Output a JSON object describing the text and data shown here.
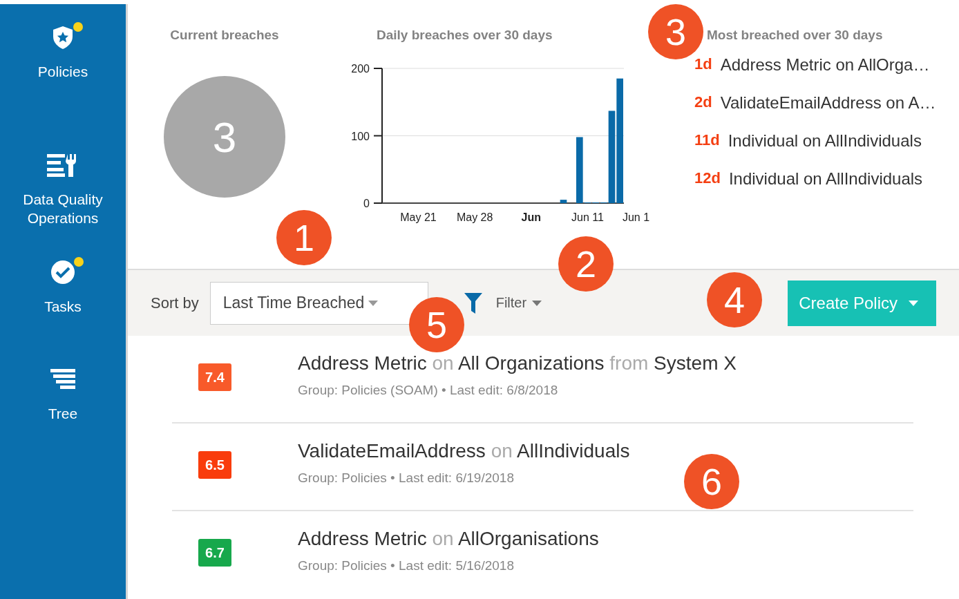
{
  "sidebar": {
    "items": [
      {
        "label": "Policies",
        "badge": true
      },
      {
        "label": "Data Quality Operations",
        "badge": false
      },
      {
        "label": "Tasks",
        "badge": true
      },
      {
        "label": "Tree",
        "badge": false
      }
    ]
  },
  "current_breaches": {
    "title": "Current breaches",
    "count": "3"
  },
  "daily_breaches": {
    "title": "Daily breaches over 30 days",
    "chart_data": {
      "type": "bar",
      "categories": [
        null,
        null,
        null,
        null,
        "May 21",
        null,
        null,
        null,
        null,
        null,
        null,
        "May 28",
        null,
        null,
        null,
        null,
        null,
        null,
        "Jun",
        null,
        null,
        null,
        null,
        null,
        null,
        "Jun 11",
        null,
        null,
        null,
        null,
        null,
        "Jun 1"
      ],
      "series": [
        {
          "color": "#0a6aa8",
          "values": [
            0,
            0,
            0,
            0,
            0,
            0,
            0,
            0,
            0,
            0,
            0,
            0,
            0,
            0,
            0,
            0,
            0,
            0,
            0,
            0,
            0,
            0,
            5,
            0,
            98,
            1,
            1,
            1,
            137,
            185,
            null,
            null
          ]
        }
      ],
      "ylim": [
        0,
        200
      ],
      "yticks": [
        0,
        100,
        200
      ]
    }
  },
  "most_breached": {
    "title": "Most breached over 30 days",
    "items": [
      {
        "age": "1d",
        "text": "Address Metric on AllOrga…"
      },
      {
        "age": "2d",
        "text": "ValidateEmailAddress on A…"
      },
      {
        "age": "11d",
        "text": "Individual on AllIndividuals"
      },
      {
        "age": "12d",
        "text": "Individual on AllIndividuals"
      }
    ]
  },
  "toolbar": {
    "sort_label": "Sort by",
    "sort_value": "Last Time Breached",
    "filter": "Filter",
    "create": "Create Policy"
  },
  "policies": [
    {
      "score": "7.4",
      "color": "#f85a2a",
      "title": [
        {
          "kind": "name",
          "text": "Address Metric"
        },
        {
          "kind": "joiner",
          "text": "on"
        },
        {
          "kind": "name",
          "text": "All Organizations"
        },
        {
          "kind": "joiner",
          "text": "from"
        },
        {
          "kind": "name",
          "text": "System X"
        }
      ],
      "meta": "Group: Policies (SOAM) • Last edit: 6/8/2018"
    },
    {
      "score": "6.5",
      "color": "#f93c0c",
      "title": [
        {
          "kind": "name",
          "text": "ValidateEmailAddress"
        },
        {
          "kind": "joiner",
          "text": "on"
        },
        {
          "kind": "name",
          "text": "AllIndividuals"
        }
      ],
      "meta": "Group: Policies • Last edit: 6/19/2018"
    },
    {
      "score": "6.7",
      "color": "#17a84c",
      "title": [
        {
          "kind": "name",
          "text": "Address Metric"
        },
        {
          "kind": "joiner",
          "text": "on"
        },
        {
          "kind": "name",
          "text": "AllOrganisations"
        }
      ],
      "meta": "Group: Policies • Last edit: 5/16/2018"
    }
  ],
  "callouts": [
    "1",
    "2",
    "3",
    "4",
    "5",
    "6"
  ]
}
